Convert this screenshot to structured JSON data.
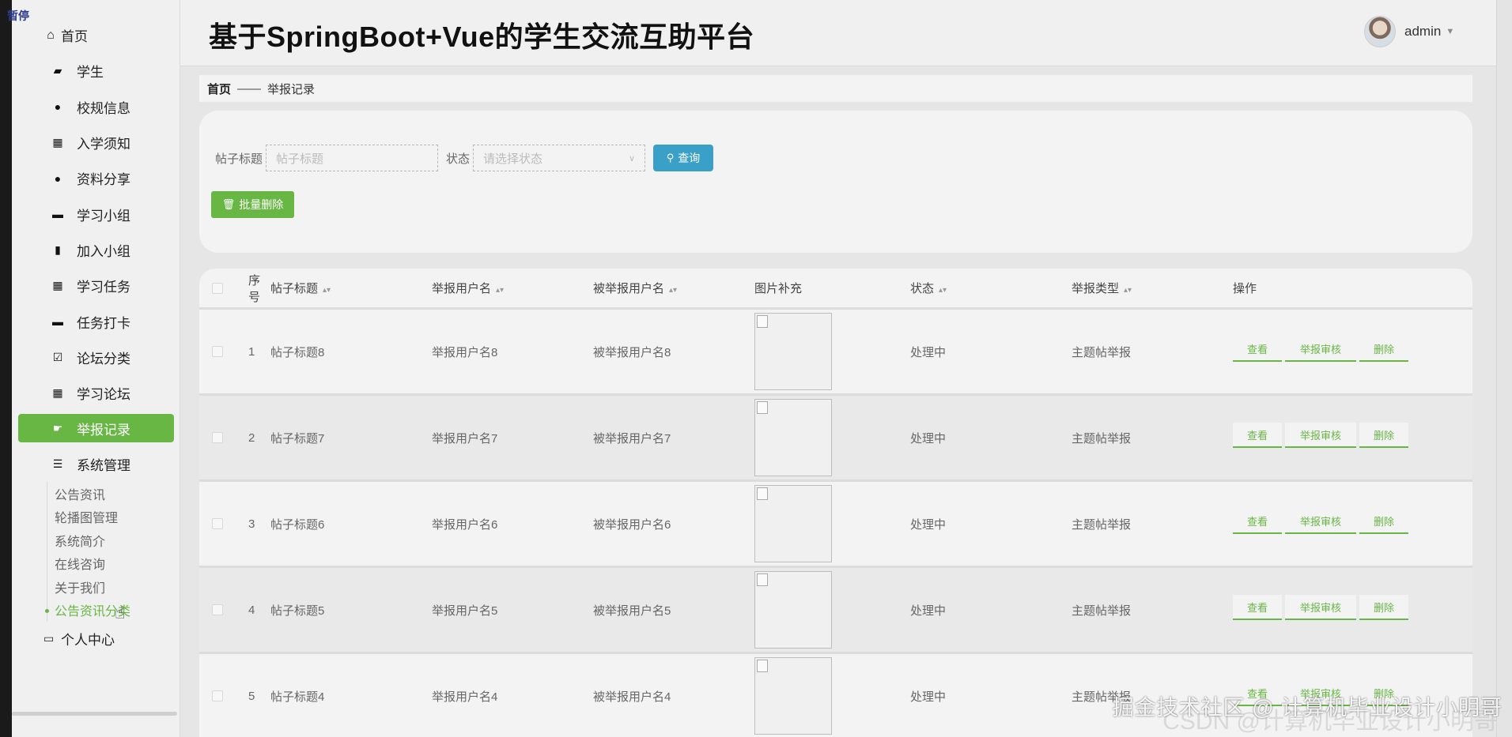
{
  "sidebar": {
    "collapse_tag": "暂停",
    "items": [
      {
        "label": "首页",
        "icon": "home-icon"
      },
      {
        "label": "学生",
        "icon": "ticket-icon"
      },
      {
        "label": "校规信息",
        "icon": "user-icon"
      },
      {
        "label": "入学须知",
        "icon": "grid-icon"
      },
      {
        "label": "资料分享",
        "icon": "bulb-icon"
      },
      {
        "label": "学习小组",
        "icon": "briefcase-icon"
      },
      {
        "label": "加入小组",
        "icon": "clipboard-icon"
      },
      {
        "label": "学习任务",
        "icon": "grid-icon"
      },
      {
        "label": "任务打卡",
        "icon": "monitor-icon"
      },
      {
        "label": "论坛分类",
        "icon": "checklist-icon"
      },
      {
        "label": "学习论坛",
        "icon": "grid-icon"
      },
      {
        "label": "举报记录",
        "icon": "hand-icon",
        "active": true
      },
      {
        "label": "系统管理",
        "icon": "list-icon"
      }
    ],
    "submenu": [
      {
        "label": "公告资讯"
      },
      {
        "label": "轮播图管理"
      },
      {
        "label": "系统简介"
      },
      {
        "label": "在线咨询"
      },
      {
        "label": "关于我们"
      },
      {
        "label": "公告资讯分类",
        "current": true
      }
    ],
    "personal": "个人中心"
  },
  "header": {
    "title": "基于SpringBoot+Vue的学生交流互助平台",
    "username": "admin"
  },
  "breadcrumb": {
    "home": "首页",
    "separator": "——",
    "current": "举报记录"
  },
  "search": {
    "title_label": "帖子标题",
    "title_placeholder": "帖子标题",
    "state_label": "状态",
    "state_placeholder": "请选择状态",
    "query_button": "查询",
    "batch_delete_button": "批量删除"
  },
  "table": {
    "headers": {
      "index": "序号",
      "title": "帖子标题",
      "reporter": "举报用户名",
      "reported": "被举报用户名",
      "image": "图片补充",
      "state": "状态",
      "type": "举报类型",
      "ops": "操作"
    },
    "rows": [
      {
        "index": "1",
        "title": "帖子标题8",
        "reporter": "举报用户名8",
        "reported": "被举报用户名8",
        "state": "处理中",
        "type": "主题帖举报"
      },
      {
        "index": "2",
        "title": "帖子标题7",
        "reporter": "举报用户名7",
        "reported": "被举报用户名7",
        "state": "处理中",
        "type": "主题帖举报"
      },
      {
        "index": "3",
        "title": "帖子标题6",
        "reporter": "举报用户名6",
        "reported": "被举报用户名6",
        "state": "处理中",
        "type": "主题帖举报"
      },
      {
        "index": "4",
        "title": "帖子标题5",
        "reporter": "举报用户名5",
        "reported": "被举报用户名5",
        "state": "处理中",
        "type": "主题帖举报"
      },
      {
        "index": "5",
        "title": "帖子标题4",
        "reporter": "举报用户名4",
        "reported": "被举报用户名4",
        "state": "处理中",
        "type": "主题帖举报"
      }
    ],
    "ops": {
      "view": "查看",
      "audit": "举报审核",
      "delete": "删除"
    }
  },
  "watermark": "掘金技术社区 @ 计算机毕业设计小明哥",
  "watermark_csdn": "CSDN @计算机毕业设计小明哥",
  "colors": {
    "accent": "#68b745",
    "query": "#3aa0c7"
  }
}
